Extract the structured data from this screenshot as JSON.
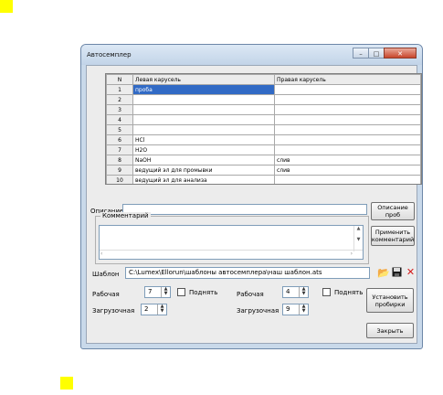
{
  "window": {
    "title": "Автосемплер"
  },
  "grid": {
    "headers": {
      "n": "N",
      "left": "Левая карусель",
      "right": "Правая карусель"
    },
    "rows": [
      {
        "n": "1",
        "left": "проба",
        "right": ""
      },
      {
        "n": "2",
        "left": "",
        "right": ""
      },
      {
        "n": "3",
        "left": "",
        "right": ""
      },
      {
        "n": "4",
        "left": "",
        "right": ""
      },
      {
        "n": "5",
        "left": "",
        "right": ""
      },
      {
        "n": "6",
        "left": "HCl",
        "right": ""
      },
      {
        "n": "7",
        "left": "H2O",
        "right": ""
      },
      {
        "n": "8",
        "left": "NaOH",
        "right": "слив"
      },
      {
        "n": "9",
        "left": "ведущий эл для промывки",
        "right": "слив"
      },
      {
        "n": "10",
        "left": "ведущий эл для анализа",
        "right": ""
      }
    ]
  },
  "description": {
    "label": "Описание:",
    "value": "",
    "button": "Описание проб"
  },
  "comment": {
    "legend": "Комментарий",
    "value": "",
    "button": "Применить комментарий"
  },
  "template": {
    "label": "Шаблон",
    "path": "C:\\Lumex\\Ellorun\\шаблоны автосемплера\\наш шаблон.ats"
  },
  "left_carousel": {
    "work_label": "Рабочая",
    "work_value": "7",
    "load_label": "Загрузочная",
    "load_value": "2",
    "raise_label": "Поднять"
  },
  "right_carousel": {
    "work_label": "Рабочая",
    "work_value": "4",
    "load_label": "Загрузочная",
    "load_value": "9",
    "raise_label": "Поднять"
  },
  "buttons": {
    "install": "Установить пробирки",
    "close": "Закрыть"
  },
  "colors": {
    "marker": "#ffff00",
    "selection": "#316ac5",
    "close_button": "#c8462b"
  },
  "icons": [
    "open-folder-icon",
    "save-icon",
    "delete-x-icon"
  ]
}
